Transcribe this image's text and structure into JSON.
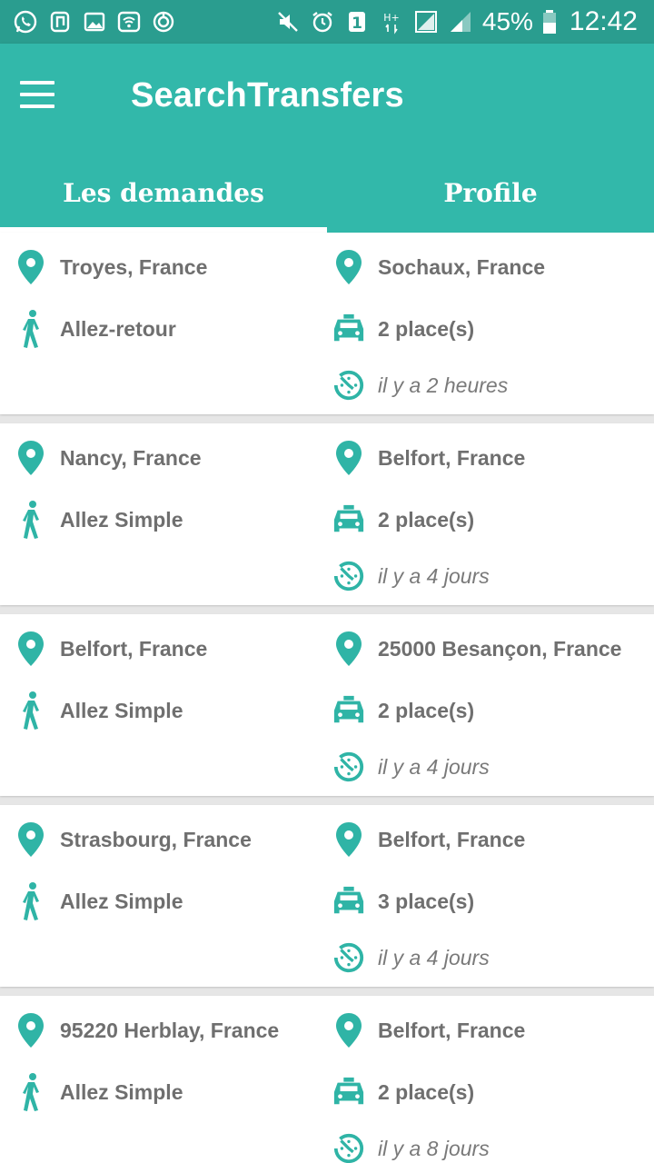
{
  "status_bar": {
    "battery": "45%",
    "time": "12:42",
    "sim": "1",
    "network": "H+"
  },
  "app_bar": {
    "title": "SearchTransfers"
  },
  "tabs": [
    {
      "label": "Les demandes",
      "active": true
    },
    {
      "label": "Profile",
      "active": false
    }
  ],
  "requests": [
    {
      "from": "Troyes, France",
      "to": "Sochaux, France",
      "trip": "Allez-retour",
      "seats": "2 place(s)",
      "time": "il y a 2 heures"
    },
    {
      "from": "Nancy, France",
      "to": "Belfort, France",
      "trip": "Allez Simple",
      "seats": "2 place(s)",
      "time": "il y a 4 jours"
    },
    {
      "from": "Belfort, France",
      "to": "25000 Besançon, France",
      "trip": "Allez Simple",
      "seats": "2 place(s)",
      "time": "il y a 4 jours"
    },
    {
      "from": "Strasbourg, France",
      "to": "Belfort, France",
      "trip": "Allez Simple",
      "seats": "3 place(s)",
      "time": "il y a 4 jours"
    },
    {
      "from": "95220 Herblay, France",
      "to": "Belfort, France",
      "trip": "Allez Simple",
      "seats": "2 place(s)",
      "time": "il y a 8 jours"
    }
  ],
  "colors": {
    "primary": "#32b8aa",
    "status_bar": "#2a9d8f",
    "accent_icon": "#2fb4a6",
    "text": "#6f6f6f"
  }
}
